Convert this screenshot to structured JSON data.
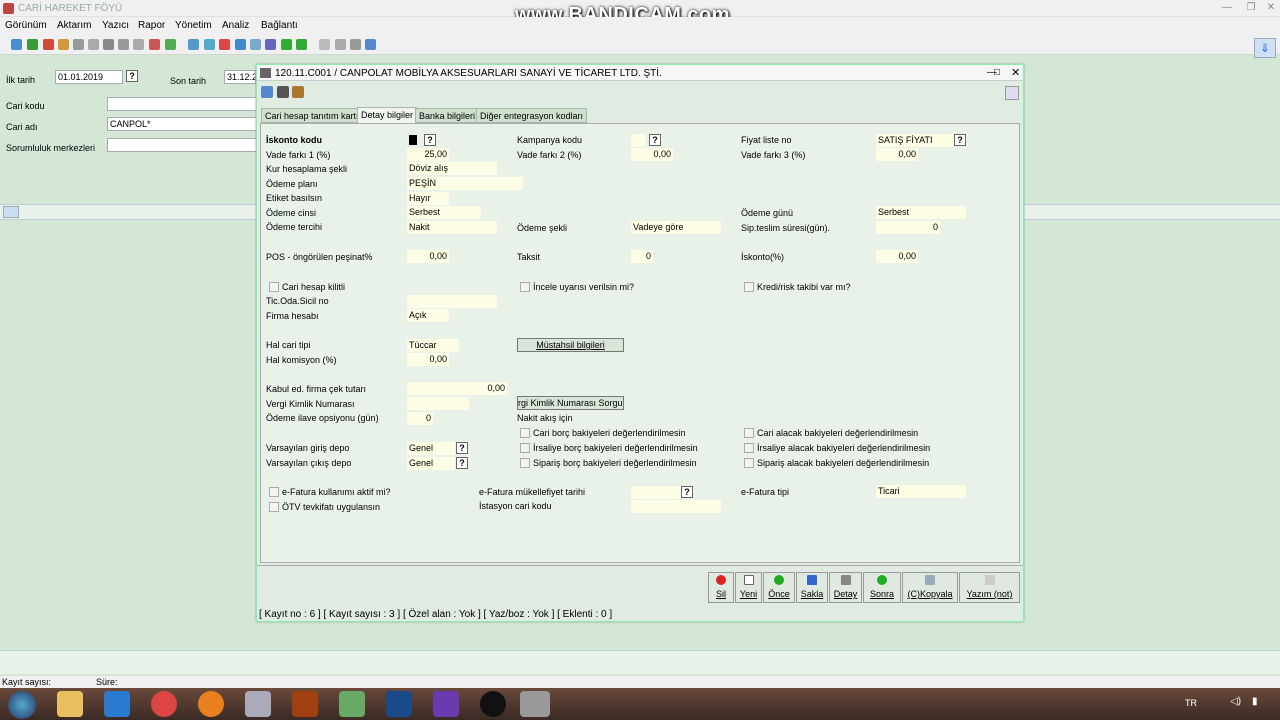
{
  "app": {
    "title": "CARİ HAREKET FÖYÜ",
    "watermark": "www.BANDICAM.com"
  },
  "menu": [
    "Görünüm",
    "Aktarım",
    "Yazıcı",
    "Rapor",
    "Yönetim",
    "Analiz",
    "Bağlantı"
  ],
  "filters": {
    "ilk_tarih_label": "İlk tarih",
    "ilk_tarih_value": "01.01.2019",
    "son_tarih_label": "Son tarih",
    "son_tarih_value": "31.12.2",
    "cari_kodu_label": "Cari kodu",
    "cari_adi_label": "Cari adı",
    "cari_adi_value": "CANPOL*",
    "sorumluluk_label": "Sorumluluk merkezleri"
  },
  "dialog": {
    "title": "120.11.C001 / CANPOLAT MOBİLYA AKSESUARLARI SANAYİ VE TİCARET LTD. ŞTİ.",
    "tabs": [
      "Cari hesap tanıtım kartı",
      "Detay bilgiler",
      "Banka bilgileri",
      "Diğer entegrasyon kodları"
    ],
    "fields": {
      "iskonto_kodu": "İskonto kodu",
      "vade1_label": "Vade farkı 1 (%)",
      "vade1_value": "25,00",
      "kur_label": "Kur hesaplama şekli",
      "kur_value": "Döviz alış",
      "odeme_plani_label": "Ödeme planı",
      "odeme_plani_value": "PEŞİN",
      "etiket_label": "Etiket basılsın",
      "etiket_value": "Hayır",
      "odeme_cinsi_label": "Ödeme cinsi",
      "odeme_cinsi_value": "Serbest",
      "odeme_tercihi_label": "Ödeme tercihi",
      "odeme_tercihi_value": "Nakit",
      "pos_label": "POS - öngörülen peşinat%",
      "pos_value": "0,00",
      "kampanya_label": "Kampanya kodu",
      "vade2_label": "Vade farkı 2 (%)",
      "vade2_value": "0,00",
      "odeme_sekli_label": "Ödeme şekli",
      "odeme_sekli_value": "Vadeye göre",
      "taksit_label": "Taksit",
      "taksit_value": "0",
      "fiyat_label": "Fiyat liste no",
      "fiyat_value": "SATIŞ FİYATI",
      "vade3_label": "Vade farkı 3 (%)",
      "vade3_value": "0,00",
      "odeme_gunu_label": "Ödeme günü",
      "odeme_gunu_value": "Serbest",
      "sip_label": "Sip.teslim süresi(gün).",
      "sip_value": "0",
      "iskonto_pct_label": "İskonto(%)",
      "iskonto_pct_value": "0,00",
      "cari_kilitli": "Cari hesap kilitli",
      "incele": "İncele uyarısı verilsin mi?",
      "kredi": "Kredi/risk takibi var mı?",
      "tic_oda_label": "Tic.Oda.Sicil no",
      "firma_hesabi_label": "Firma hesabı",
      "firma_hesabi_value": "Açık",
      "hal_cari_label": "Hal cari tipi",
      "hal_cari_value": "Tüccar",
      "mustahsil_btn": "Müstahsil bilgileri",
      "hal_kom_label": "Hal komisyon (%)",
      "hal_kom_value": "0,00",
      "kabul_label": "Kabul ed. firma çek tutarı",
      "kabul_value": "0,00",
      "vkn_label": "Vergi Kimlik Numarası",
      "vkn_btn": "rgi Kimlik Numarası Sorgular",
      "ilave_label": "Ödeme ilave opsiyonu (gün)",
      "ilave_value": "0",
      "nakit_akis": "Nakit akış için",
      "cb1": "Cari borç bakiyeleri değerlendirilmesin",
      "cb2": "İrsaliye borç bakiyeleri değerlendirilmesin",
      "cb3": "Sipariş borç bakiyeleri değerlendirilmesin",
      "cb4": "Cari alacak bakiyeleri değerlendirilmesin",
      "cb5": "İrsaliye alacak bakiyeleri değerlendirilmesin",
      "cb6": "Sipariş alacak bakiyeleri değerlendirilmesin",
      "giris_depo_label": "Varsayılan giriş depo",
      "giris_depo_value": "Genel",
      "cikis_depo_label": "Varsayılan çıkış depo",
      "cikis_depo_value": "Genel",
      "efatura_aktif": "e-Fatura kullanımı aktif mi?",
      "otv": "ÖTV tevkifatı uygulansın",
      "efatura_mukellef_label": "e-Fatura mükellefiyet tarihi",
      "istasyon_label": "İstasyon cari kodu",
      "efatura_tipi_label": "e-Fatura tipi",
      "efatura_tipi_value": "Ticari"
    },
    "buttons": [
      {
        "label": "Sil",
        "color": "#d22"
      },
      {
        "label": "Yeni",
        "color": "#fff"
      },
      {
        "label": "Önce",
        "color": "#2a2"
      },
      {
        "label": "Sakla",
        "color": "#36c"
      },
      {
        "label": "Detay",
        "color": "#888"
      },
      {
        "label": "Sonra",
        "color": "#2a2"
      },
      {
        "label": "(C)Kopyala",
        "color": "#9ab"
      },
      {
        "label": "Yazım (not)",
        "color": "#ccc"
      }
    ],
    "status": "[ Kayıt no : 6 ] [ Kayıt sayısı : 3 ] [ Özel alan : Yok ] [ Yaz/boz : Yok ] [ Eklenti : 0 ]"
  },
  "bottom": {
    "kayit": "Kayıt sayısı:",
    "sure": "Süre:"
  },
  "taskbar": {
    "lang": "TR"
  }
}
